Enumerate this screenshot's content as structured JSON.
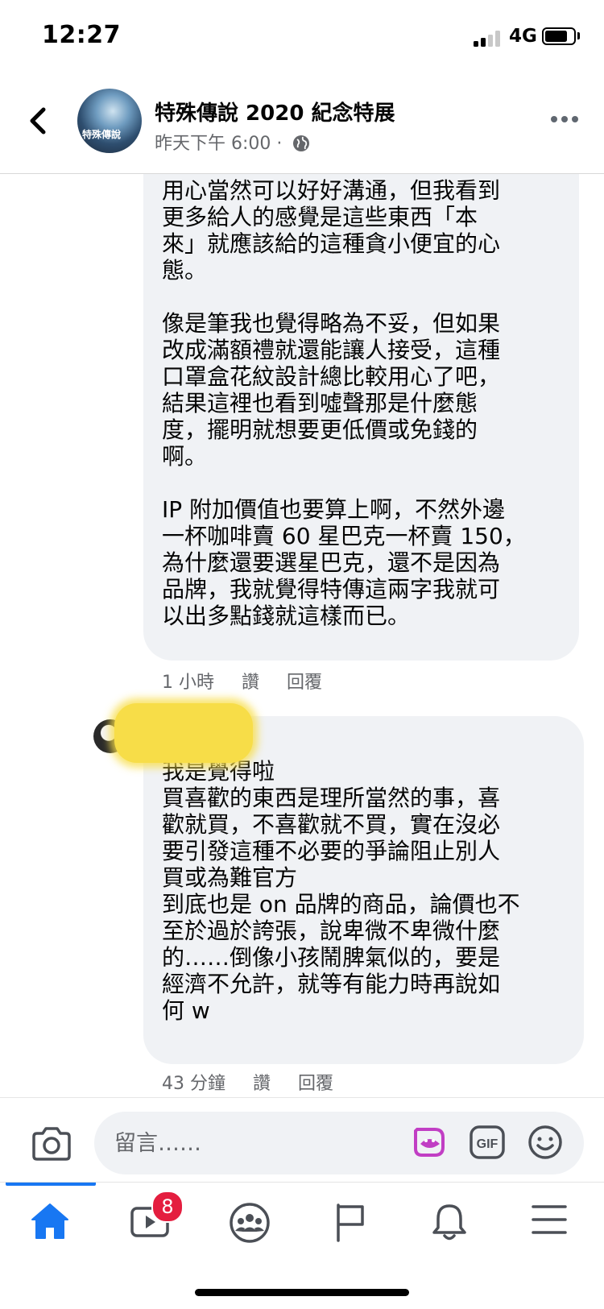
{
  "status_bar": {
    "time": "12:27",
    "network": "4G",
    "signal_bars": 4,
    "signal_bars_filled": 2,
    "battery_level": 0.78
  },
  "post_header": {
    "page_name": "特殊傳說 2020 紀念特展",
    "timestamp": "昨天下午 6:00 ·",
    "avatar_text": "特殊傳說",
    "icons": {
      "back": "chevron-left-icon",
      "privacy": "globe-icon",
      "more": "more-dots-icon"
    }
  },
  "comments": [
    {
      "text": "用心當然可以好好溝通，但我看到\n更多給人的感覺是這些東西「本\n來」就應該給的這種貪小便宜的心\n態。\n\n像是筆我也覺得略為不妥，但如果\n改成滿額禮就還能讓人接受，這種\n口罩盒花紋設計總比較用心了吧，\n結果這裡也看到噓聲那是什麼態\n度，擺明就想要更低價或免錢的\n啊。\n\nIP 附加價值也要算上啊，不然外邊\n一杯咖啡賣 60 星巴克一杯賣 150，\n為什麼還要選星巴克，還不是因為\n品牌，我就覺得特傳這兩字我就可\n以出多點錢就這樣而已。",
      "time": "1 小時",
      "like_label": "讚",
      "reply_label": "回覆"
    },
    {
      "text": "我是覺得啦\n買喜歡的東西是理所當然的事，喜\n歡就買，不喜歡就不買，實在沒必\n要引發這種不必要的爭論阻止別人\n買或為難官方\n到底也是 on 品牌的商品，論價也不\n至於過於誇張，說卑微不卑微什麼\n的……倒像小孩鬧脾氣似的，要是\n經濟不允許，就等有能力時再說如\n何 w",
      "time": "43 分鐘",
      "like_label": "讚",
      "reply_label": "回覆"
    }
  ],
  "composer": {
    "placeholder": "留言……",
    "icons": [
      "camera-icon",
      "avatar-sticker-icon",
      "gif-icon",
      "emoji-icon"
    ]
  },
  "tab_bar": {
    "tabs": [
      {
        "name": "home",
        "icon": "home-icon",
        "active": true
      },
      {
        "name": "watch",
        "icon": "video-icon",
        "badge": "8"
      },
      {
        "name": "groups",
        "icon": "groups-icon"
      },
      {
        "name": "pages",
        "icon": "flag-icon"
      },
      {
        "name": "notifications",
        "icon": "bell-icon"
      },
      {
        "name": "menu",
        "icon": "menu-icon"
      }
    ]
  },
  "colors": {
    "accent": "#1877f2",
    "bubble": "#f0f2f5",
    "secondary_text": "#65676b",
    "badge": "#e41e3f",
    "sticker_accent": "#c13ec4"
  }
}
